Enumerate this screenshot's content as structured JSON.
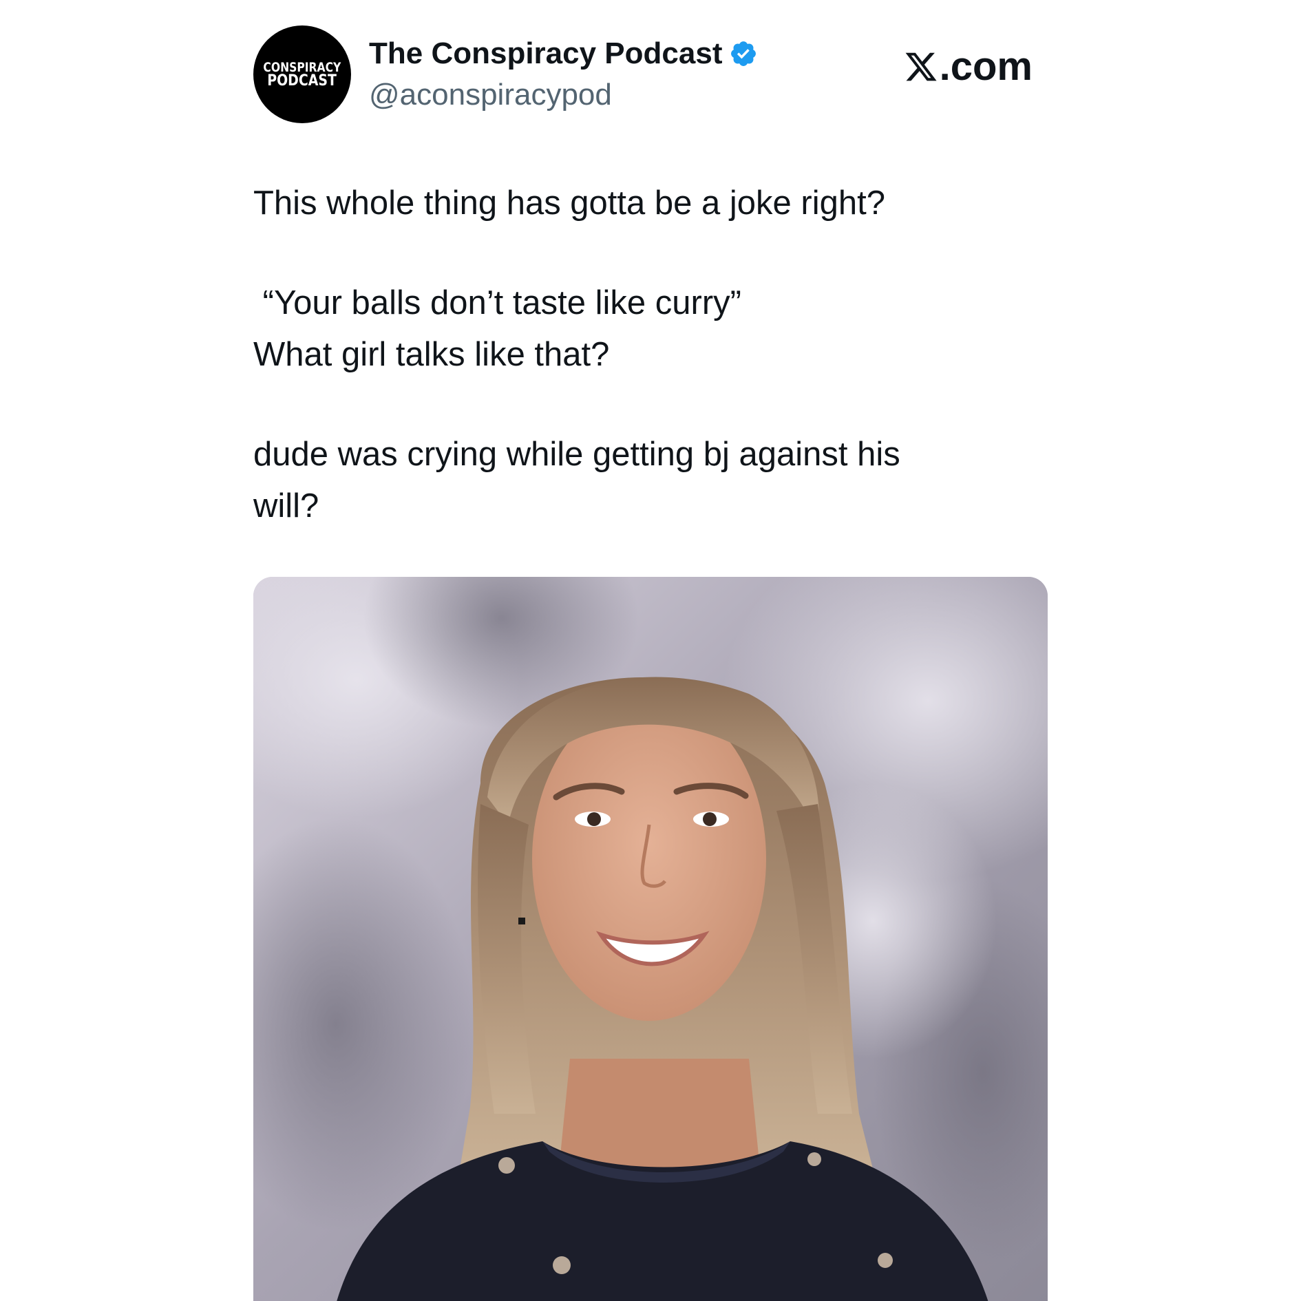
{
  "author": {
    "display_name": "The Conspiracy Podcast",
    "handle": "@aconspiracypod",
    "verified": true,
    "avatar_logo_top": "CONSPIRACY",
    "avatar_logo_bottom": "PODCAST"
  },
  "site": {
    "label": ".com",
    "icon": "x-logo-icon"
  },
  "tweet": {
    "line1": "This whole thing has gotta be a joke right?",
    "line2": " “Your balls don’t taste like curry”",
    "line3": "What girl talks like that?",
    "line4": "dude was crying while getting bj against his",
    "line5": "will?"
  },
  "media": {
    "type": "photo"
  },
  "colors": {
    "text": "#0f1419",
    "secondary": "#536471",
    "verified": "#1d9bf0"
  }
}
